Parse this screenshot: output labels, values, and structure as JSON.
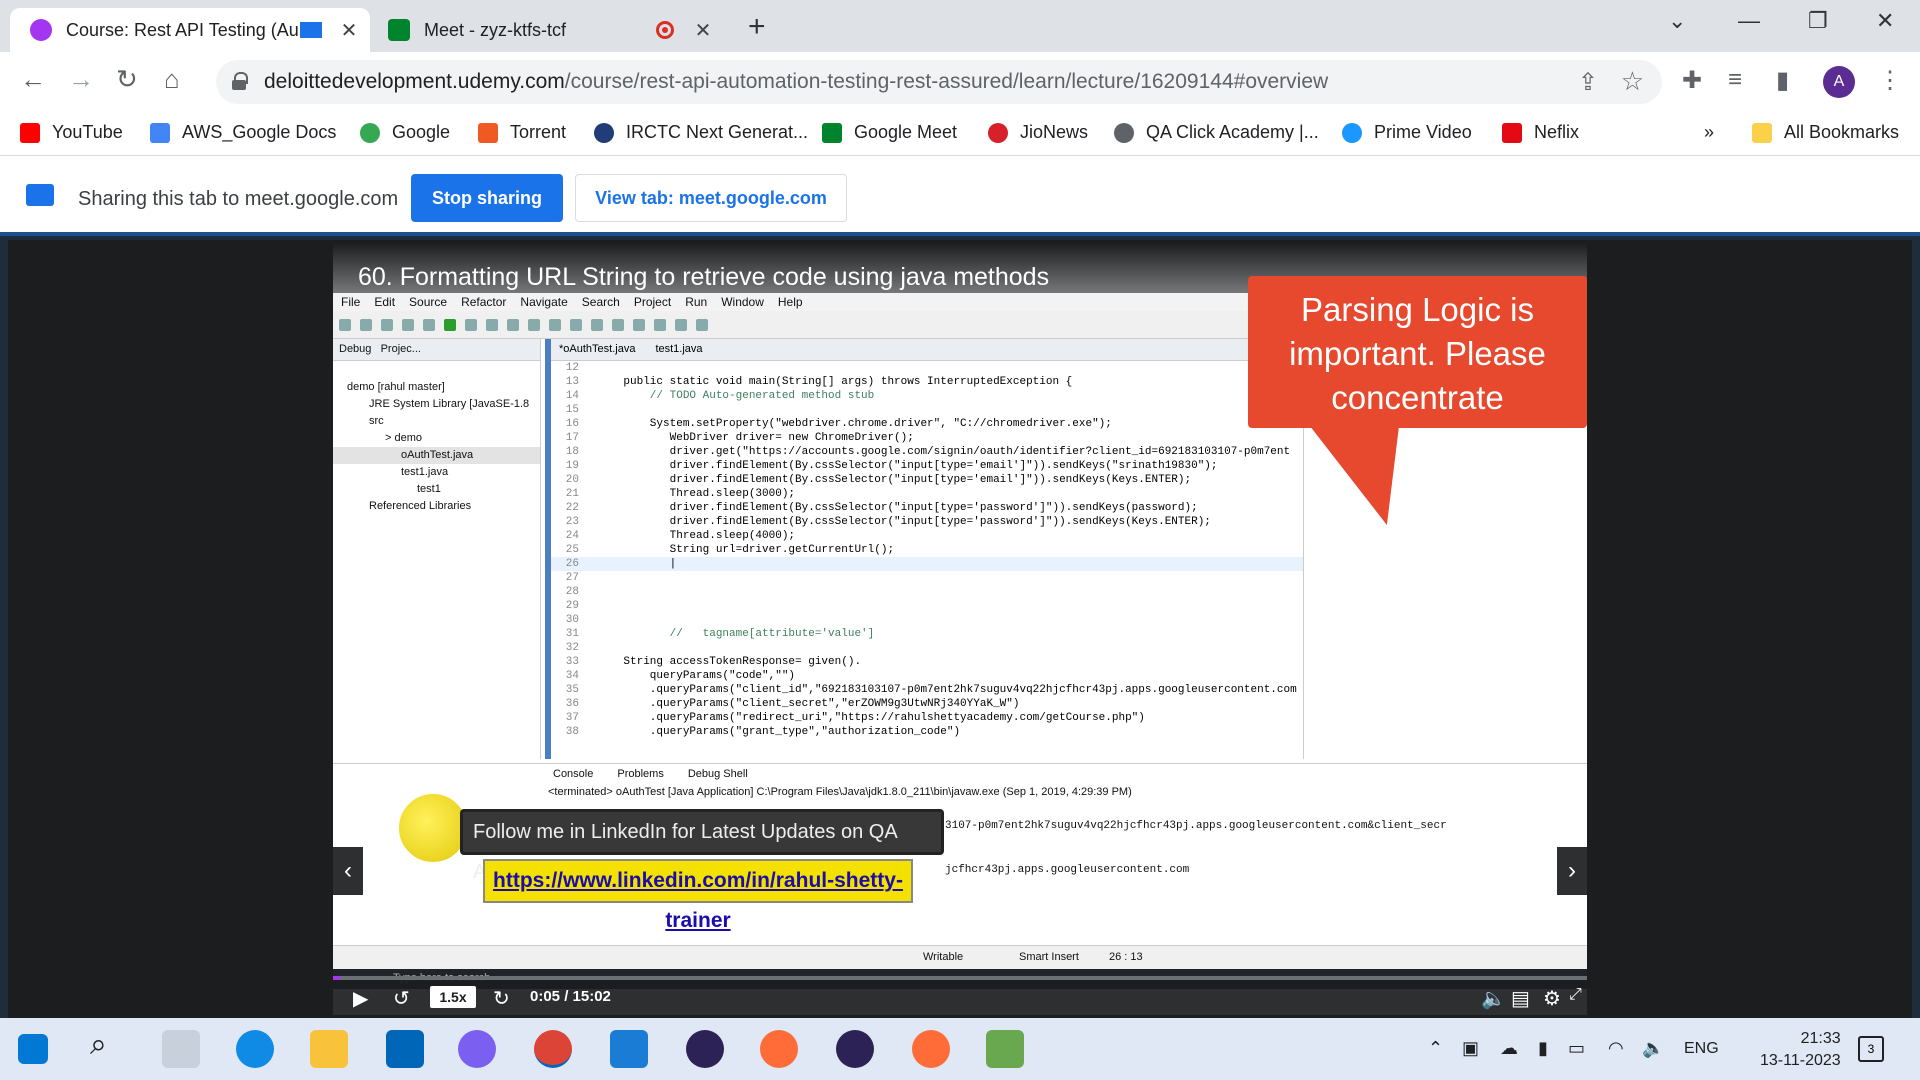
{
  "browser": {
    "tabs": [
      {
        "title": "Course: Rest API Testing (Au",
        "active": true,
        "favicon_color": "#a435f0"
      },
      {
        "title": "Meet - zyz-ktfs-tcf",
        "active": false,
        "favicon_color": "#00832d"
      }
    ],
    "address": {
      "host": "deloittedevelopment.udemy.com",
      "path": "/course/rest-api-automation-testing-rest-assured/learn/lecture/16209144#overview"
    },
    "avatar_letter": "A",
    "bookmarks": [
      "YouTube",
      "AWS_Google Docs",
      "Google",
      "Torrent",
      "IRCTC Next Generat...",
      "Google Meet",
      "JioNews",
      "QA Click Academy |...",
      "Prime Video",
      "Neflix"
    ],
    "bookmarks_overflow": "»",
    "all_bookmarks": "All Bookmarks"
  },
  "share": {
    "text": "Sharing this tab to meet.google.com",
    "stop_label": "Stop sharing",
    "view_label": "View tab: meet.google.com"
  },
  "video": {
    "title": "60. Formatting URL String to retrieve code using java methods",
    "callout": "Parsing Logic is important. Please concentrate",
    "follow_text": "Follow me in LinkedIn for Latest Updates on QA Automation",
    "link_text": "https://www.linkedin.com/in/rahul-shetty-trainer",
    "speed": "1.5x",
    "time": "0:05 / 15:02",
    "progress_fraction": 0.0055
  },
  "eclipse": {
    "menu": [
      "File",
      "Edit",
      "Source",
      "Refactor",
      "Navigate",
      "Search",
      "Project",
      "Run",
      "Window",
      "Help"
    ],
    "pkg_tabs": [
      "Debug",
      "Projec..."
    ],
    "tree": [
      "demo [rahul master]",
      "JRE System Library [JavaSE-1.8",
      "src",
      "> demo",
      "oAuthTest.java",
      "test1.java",
      "test1",
      "Referenced Libraries"
    ],
    "editor_tabs": [
      "*oAuthTest.java",
      "test1.java"
    ],
    "code_lines": [
      {
        "n": "12",
        "t": ""
      },
      {
        "n": "13",
        "t": "    public static void main(String[] args) throws InterruptedException {"
      },
      {
        "n": "14",
        "t": "        // TODO Auto-generated method stub"
      },
      {
        "n": "15",
        "t": ""
      },
      {
        "n": "16",
        "t": "        System.setProperty(\"webdriver.chrome.driver\", \"C://chromedriver.exe\");"
      },
      {
        "n": "17",
        "t": "           WebDriver driver= new ChromeDriver();"
      },
      {
        "n": "18",
        "t": "           driver.get(\"https://accounts.google.com/signin/oauth/identifier?client_id=692183103107-p0m7ent"
      },
      {
        "n": "19",
        "t": "           driver.findElement(By.cssSelector(\"input[type='email']\")).sendKeys(\"srinath19830\");"
      },
      {
        "n": "20",
        "t": "           driver.findElement(By.cssSelector(\"input[type='email']\")).sendKeys(Keys.ENTER);"
      },
      {
        "n": "21",
        "t": "           Thread.sleep(3000);"
      },
      {
        "n": "22",
        "t": "           driver.findElement(By.cssSelector(\"input[type='password']\")).sendKeys(password);"
      },
      {
        "n": "23",
        "t": "           driver.findElement(By.cssSelector(\"input[type='password']\")).sendKeys(Keys.ENTER);"
      },
      {
        "n": "24",
        "t": "           Thread.sleep(4000);"
      },
      {
        "n": "25",
        "t": "           String url=driver.getCurrentUrl();"
      },
      {
        "n": "26",
        "t": "           |"
      },
      {
        "n": "27",
        "t": ""
      },
      {
        "n": "28",
        "t": ""
      },
      {
        "n": "29",
        "t": ""
      },
      {
        "n": "30",
        "t": ""
      },
      {
        "n": "31",
        "t": "           //   tagname[attribute='value']"
      },
      {
        "n": "32",
        "t": ""
      },
      {
        "n": "33",
        "t": "    String accessTokenResponse= given()."
      },
      {
        "n": "34",
        "t": "        queryParams(\"code\",\"\")"
      },
      {
        "n": "35",
        "t": "        .queryParams(\"client_id\",\"692183103107-p0m7ent2hk7suguv4vq22hjcfhcr43pj.apps.googleusercontent.com"
      },
      {
        "n": "36",
        "t": "        .queryParams(\"client_secret\",\"erZOWM9g3UtwNRj340YYaK_W\")"
      },
      {
        "n": "37",
        "t": "        .queryParams(\"redirect_uri\",\"https://rahulshettyacademy.com/getCourse.php\")"
      },
      {
        "n": "38",
        "t": "        .queryParams(\"grant_type\",\"authorization_code\")"
      }
    ],
    "console_tabs": [
      "Console",
      "Problems",
      "Debug Shell"
    ],
    "console_term": "<terminated> oAuthTest [Java Application] C:\\Program Files\\Java\\jdk1.8.0_211\\bin\\javaw.exe (Sep 1, 2019, 4:29:39 PM)",
    "console_out1": "3107-p0m7ent2hk7suguv4vq22hjcfhcr43pj.apps.googleusercontent.com&client_secr",
    "console_out2": "jcfhcr43pj.apps.googleusercontent.com",
    "status": {
      "writable": "Writable",
      "insert": "Smart Insert",
      "pos": "26 : 13"
    },
    "inner_search": "Type here to search"
  },
  "taskbar": {
    "lang": "ENG",
    "time": "21:33",
    "date": "13-11-2023",
    "notif_count": "3"
  }
}
